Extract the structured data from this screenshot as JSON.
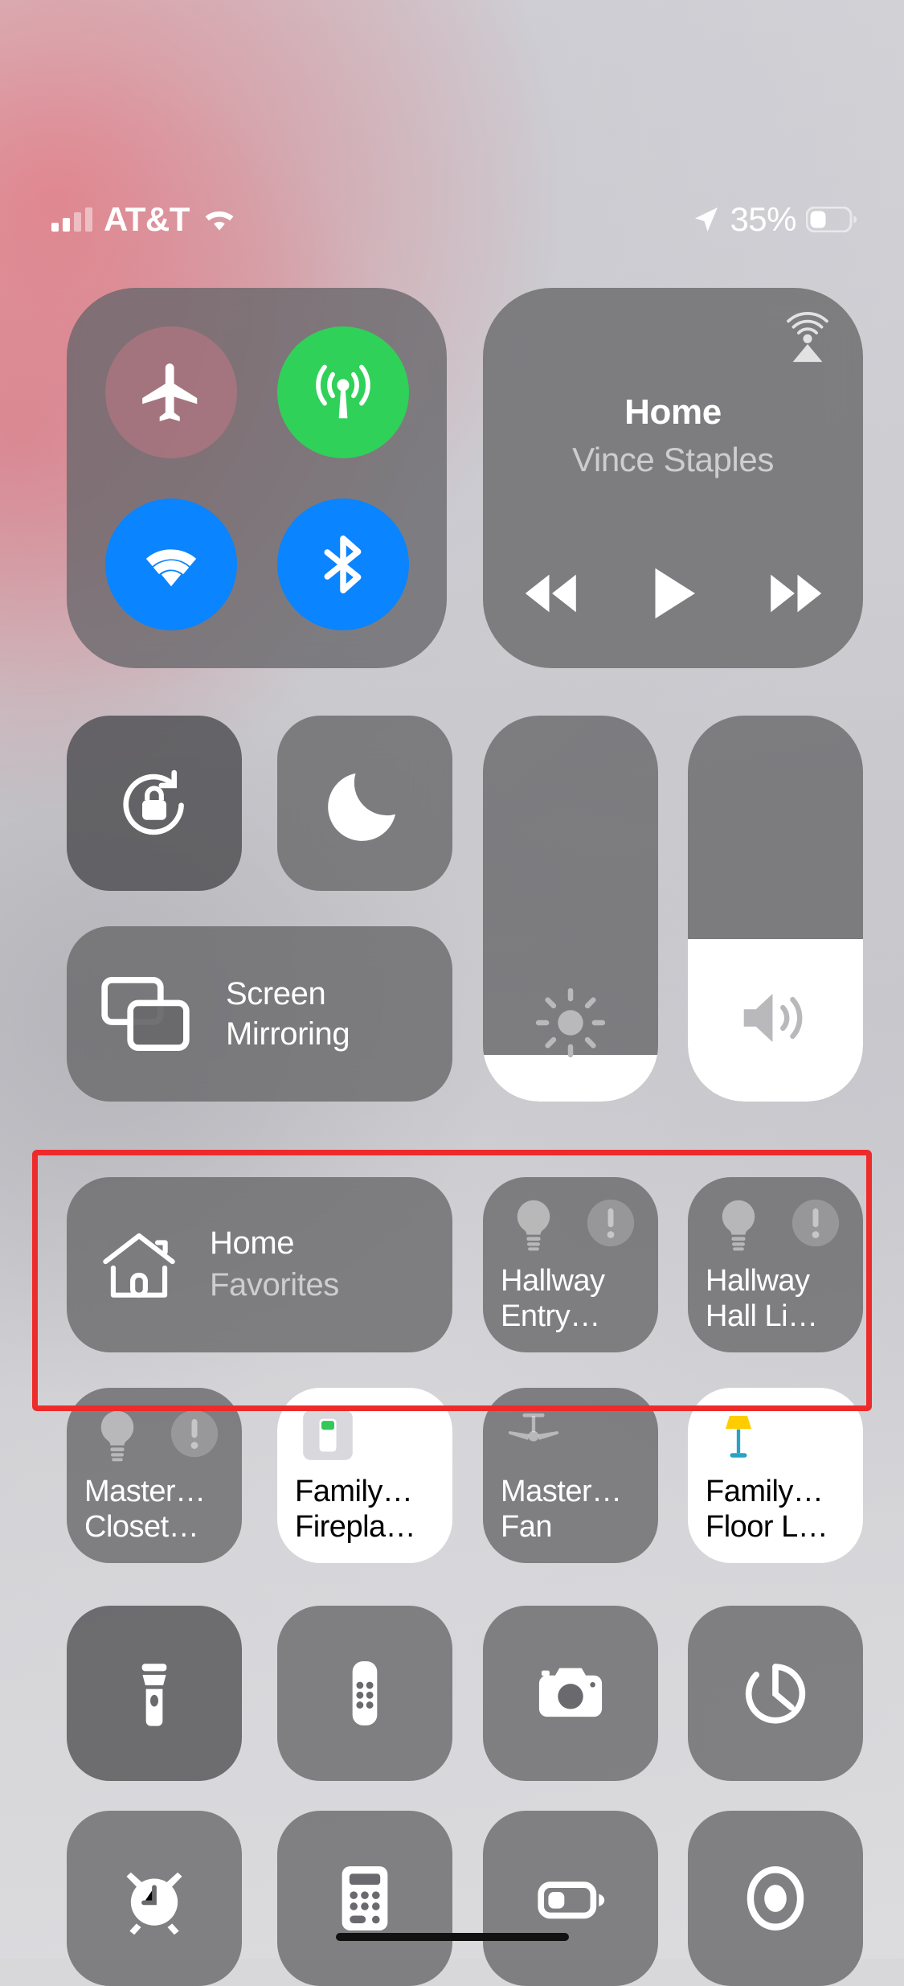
{
  "status_bar": {
    "carrier": "AT&T",
    "battery_percent": "35%",
    "signal_icon": "cellular-bars-icon",
    "wifi_icon": "wifi-icon",
    "location_icon": "location-arrow-icon",
    "battery_icon": "battery-icon"
  },
  "connectivity": {
    "buttons": [
      {
        "name": "airplane-mode",
        "label": "Airplane Mode",
        "state": "off",
        "color": "#bc7884"
      },
      {
        "name": "cellular-data",
        "label": "Cellular Data",
        "state": "on",
        "color": "#30d158"
      },
      {
        "name": "wifi",
        "label": "Wi-Fi",
        "state": "on",
        "color": "#0a84ff"
      },
      {
        "name": "bluetooth",
        "label": "Bluetooth",
        "state": "on",
        "color": "#0a84ff"
      }
    ]
  },
  "now_playing": {
    "title": "Home",
    "artist": "Vince Staples",
    "airplay_icon": "airplay-audio-icon",
    "controls": [
      "rewind",
      "play",
      "fast-forward"
    ],
    "play_state": "paused"
  },
  "toggles": {
    "rotation_lock": {
      "label": "Rotation Lock",
      "state": "on"
    },
    "do_not_disturb": {
      "label": "Do Not Disturb",
      "state": "off"
    }
  },
  "screen_mirroring": {
    "line1": "Screen",
    "line2": "Mirroring"
  },
  "sliders": {
    "brightness": {
      "label": "Brightness",
      "percent": 12
    },
    "volume": {
      "label": "Volume",
      "percent": 42
    }
  },
  "home": {
    "favorites_tile": {
      "title": "Home",
      "subtitle": "Favorites",
      "icon": "house-icon"
    },
    "accessories": [
      {
        "line1": "Hallway",
        "line2": "Entry…",
        "icon": "lightbulb-icon",
        "badge": "exclamation-badge",
        "state": "off"
      },
      {
        "line1": "Hallway",
        "line2": "Hall Li…",
        "icon": "lightbulb-icon",
        "badge": "exclamation-badge",
        "state": "off"
      },
      {
        "line1": "Master…",
        "line2": "Closet…",
        "icon": "lightbulb-icon",
        "badge": "exclamation-badge",
        "state": "off"
      },
      {
        "line1": "Family…",
        "line2": "Firepla…",
        "icon": "light-switch-icon",
        "badge": "",
        "state": "on"
      },
      {
        "line1": "Master…",
        "line2": "Fan",
        "icon": "ceiling-fan-icon",
        "badge": "",
        "state": "off"
      },
      {
        "line1": "Family…",
        "line2": "Floor L…",
        "icon": "floor-lamp-icon",
        "badge": "",
        "state": "on"
      }
    ]
  },
  "utilities": [
    {
      "name": "flashlight",
      "label": "Flashlight"
    },
    {
      "name": "apple-tv-remote",
      "label": "Apple TV Remote"
    },
    {
      "name": "camera",
      "label": "Camera"
    },
    {
      "name": "timer",
      "label": "Timer"
    },
    {
      "name": "alarm",
      "label": "Alarm"
    },
    {
      "name": "calculator",
      "label": "Calculator"
    },
    {
      "name": "low-power-mode",
      "label": "Low Power Mode"
    },
    {
      "name": "screen-record",
      "label": "Screen Recording"
    }
  ],
  "highlight": {
    "color": "#ee2b2b",
    "target": "home-controls-section"
  }
}
